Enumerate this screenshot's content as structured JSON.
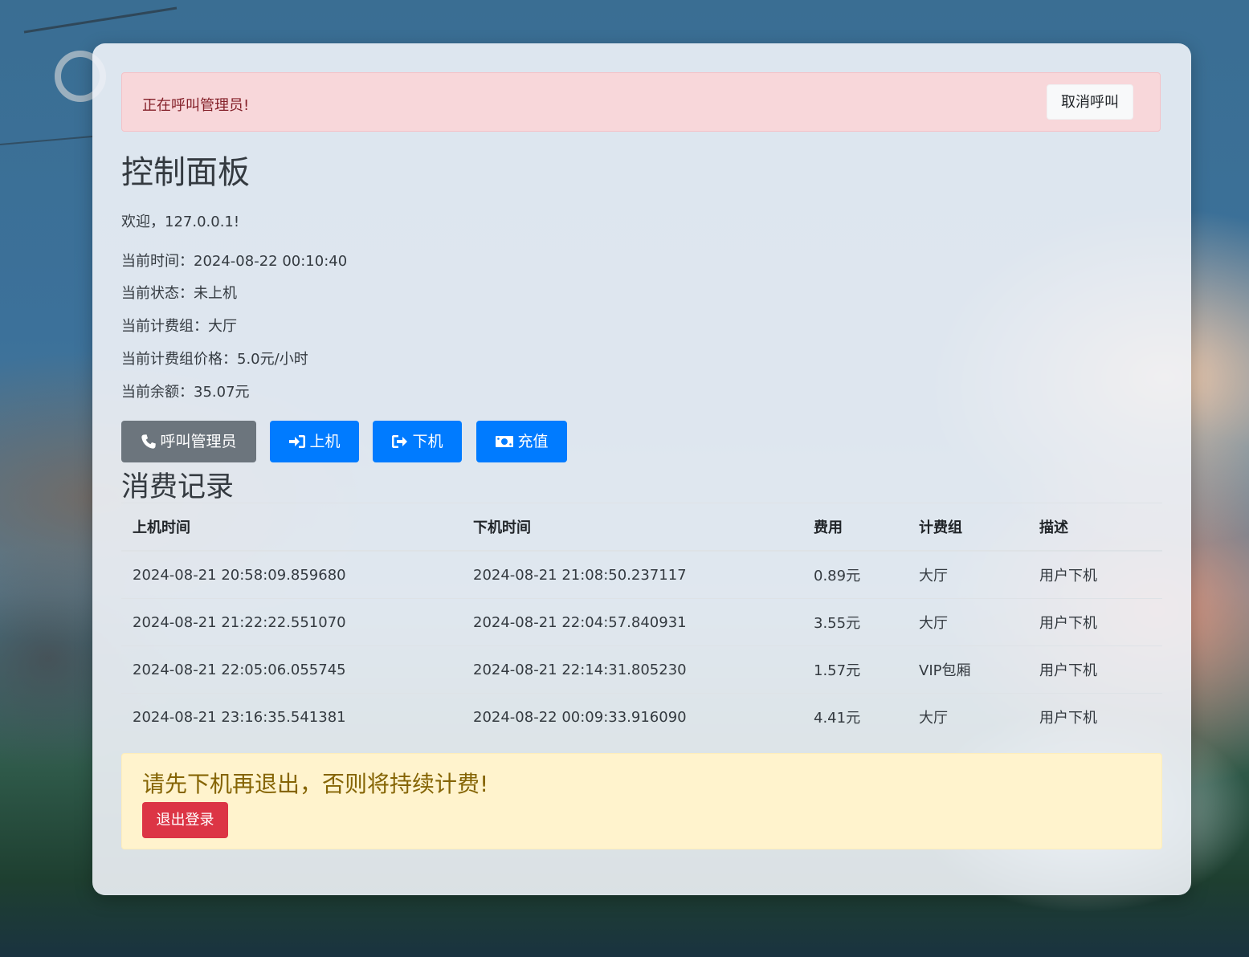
{
  "alert": {
    "message": "正在呼叫管理员!",
    "cancel_label": "取消呼叫"
  },
  "dashboard": {
    "title": "控制面板",
    "welcome": "欢迎，127.0.0.1!",
    "info": [
      "当前时间：2024-08-22 00:10:40",
      "当前状态：未上机",
      "当前计费组：大厅",
      "当前计费组价格：5.0元/小时",
      "当前余额：35.07元"
    ]
  },
  "actions": {
    "call_admin": "呼叫管理员",
    "login_machine": "上机",
    "logout_machine": "下机",
    "recharge": "充值"
  },
  "records": {
    "title": "消费记录",
    "headers": [
      "上机时间",
      "下机时间",
      "费用",
      "计费组",
      "描述"
    ],
    "rows": [
      [
        "2024-08-21 20:58:09.859680",
        "2024-08-21 21:08:50.237117",
        "0.89元",
        "大厅",
        "用户下机"
      ],
      [
        "2024-08-21 21:22:22.551070",
        "2024-08-21 22:04:57.840931",
        "3.55元",
        "大厅",
        "用户下机"
      ],
      [
        "2024-08-21 22:05:06.055745",
        "2024-08-21 22:14:31.805230",
        "1.57元",
        "VIP包厢",
        "用户下机"
      ],
      [
        "2024-08-21 23:16:35.541381",
        "2024-08-22 00:09:33.916090",
        "4.41元",
        "大厅",
        "用户下机"
      ]
    ]
  },
  "warning": {
    "message": "请先下机再退出，否则将持续计费!",
    "logout_label": "退出登录"
  },
  "colors": {
    "danger_alert_bg": "#f8d7da",
    "warning_alert_bg": "#fff3cd",
    "primary": "#007bff",
    "secondary": "#6c757d",
    "danger": "#dc3545"
  },
  "icons": {
    "call_admin": "phone-icon",
    "login_machine": "sign-in-icon",
    "logout_machine": "sign-out-icon",
    "recharge": "money-bill-icon"
  }
}
